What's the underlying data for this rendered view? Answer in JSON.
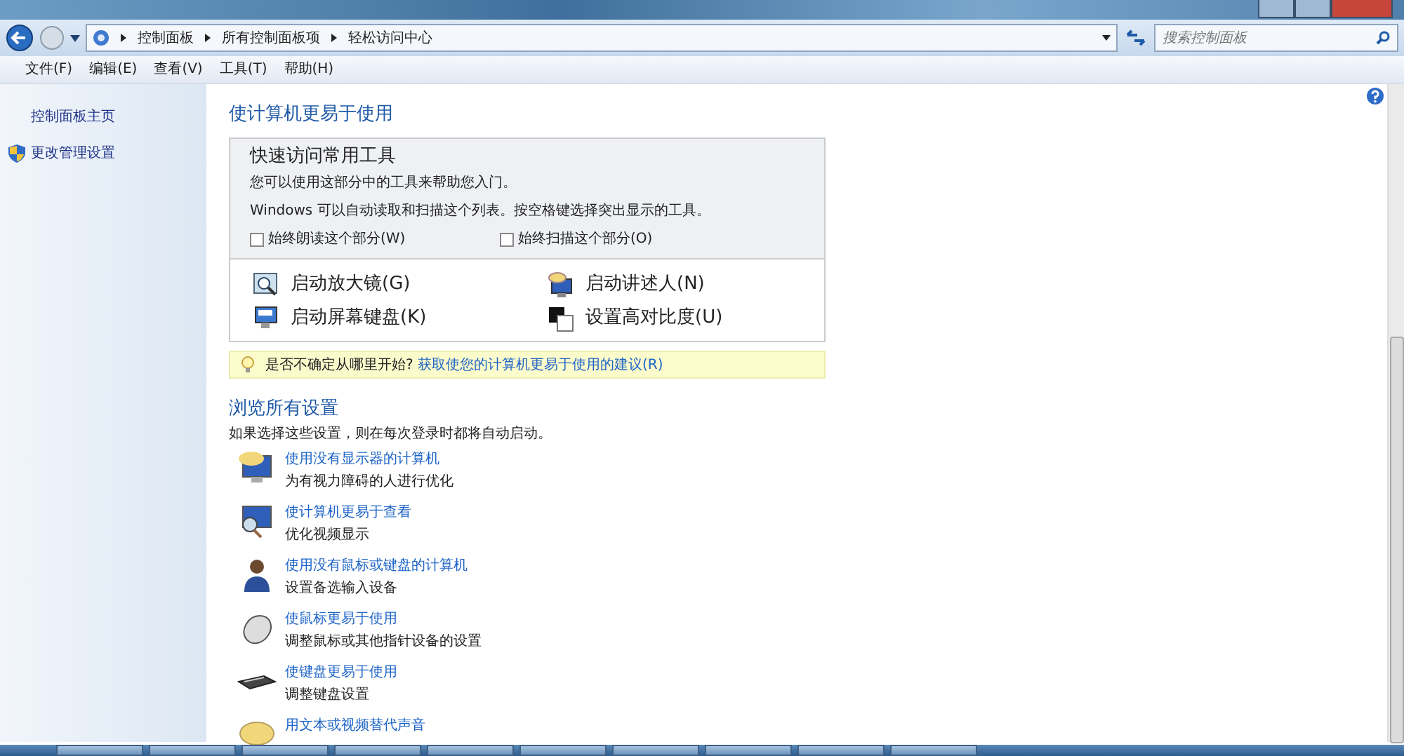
{
  "address_bar": {
    "breadcrumbs": [
      "控制面板",
      "所有控制面板项",
      "轻松访问中心"
    ],
    "search_placeholder": "搜索控制面板"
  },
  "menu": [
    "文件(F)",
    "编辑(E)",
    "查看(V)",
    "工具(T)",
    "帮助(H)"
  ],
  "sidebar": {
    "items": [
      {
        "label": "控制面板主页",
        "kind": "plain"
      },
      {
        "label": "更改管理设置",
        "kind": "shield"
      }
    ]
  },
  "main": {
    "title": "使计算机更易于使用",
    "quick_tools": {
      "heading": "快速访问常用工具",
      "description": "您可以使用这部分中的工具来帮助您入门。",
      "hint": "Windows 可以自动读取和扫描这个列表。按空格键选择突出显示的工具。",
      "checkboxes": [
        {
          "label": "始终朗读这个部分(W)",
          "checked": false
        },
        {
          "label": "始终扫描这个部分(O)",
          "checked": false
        }
      ],
      "tools": [
        {
          "label": "启动放大镜(G)"
        },
        {
          "label": "启动讲述人(N)"
        },
        {
          "label": "启动屏幕键盘(K)"
        },
        {
          "label": "设置高对比度(U)"
        }
      ]
    },
    "tip": {
      "question": "是否不确定从哪里开始?",
      "link": "获取使您的计算机更易于使用的建议(R)"
    },
    "browse": {
      "title": "浏览所有设置",
      "description": "如果选择这些设置，则在每次登录时都将自动启动。",
      "items": [
        {
          "link": "使用没有显示器的计算机",
          "description": "为有视力障碍的人进行优化"
        },
        {
          "link": "使计算机更易于查看",
          "description": "优化视频显示"
        },
        {
          "link": "使用没有鼠标或键盘的计算机",
          "description": "设置备选输入设备"
        },
        {
          "link": "使鼠标更易于使用",
          "description": "调整鼠标或其他指针设备的设置"
        },
        {
          "link": "使键盘更易于使用",
          "description": "调整键盘设置"
        },
        {
          "link": "用文本或视频替代声音"
        }
      ]
    }
  }
}
